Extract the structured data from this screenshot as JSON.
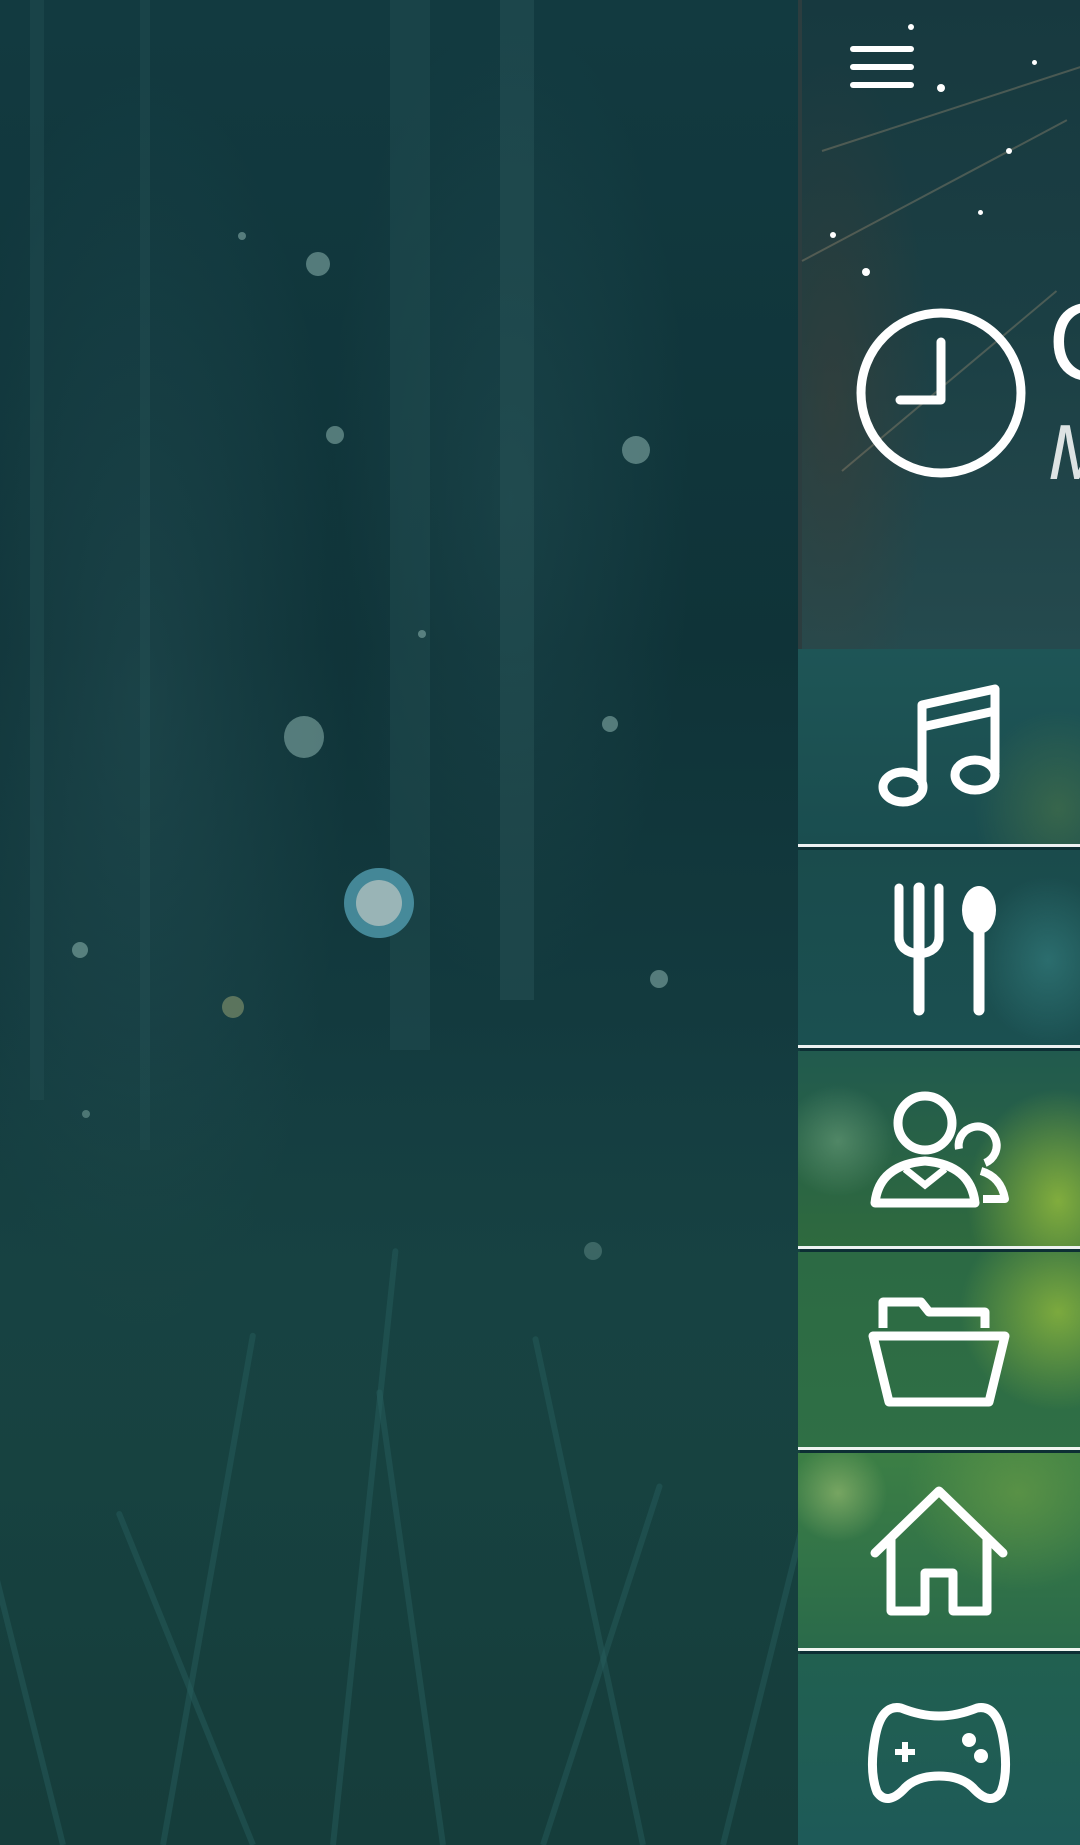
{
  "header": {
    "menu_icon": "hamburger-menu-icon",
    "clock_icon": "clock-icon",
    "title": "C",
    "subtitle": "M"
  },
  "menu": {
    "items": [
      {
        "icon": "music-note-icon"
      },
      {
        "icon": "fork-spoon-icon"
      },
      {
        "icon": "people-icon"
      },
      {
        "icon": "folder-icon"
      },
      {
        "icon": "home-icon"
      },
      {
        "icon": "gamepad-icon"
      }
    ]
  },
  "colors": {
    "panel_divider": "#ffffff",
    "icon": "#ffffff",
    "accent_green": "#5f9a3c",
    "background_dark": "#0d2f34"
  }
}
